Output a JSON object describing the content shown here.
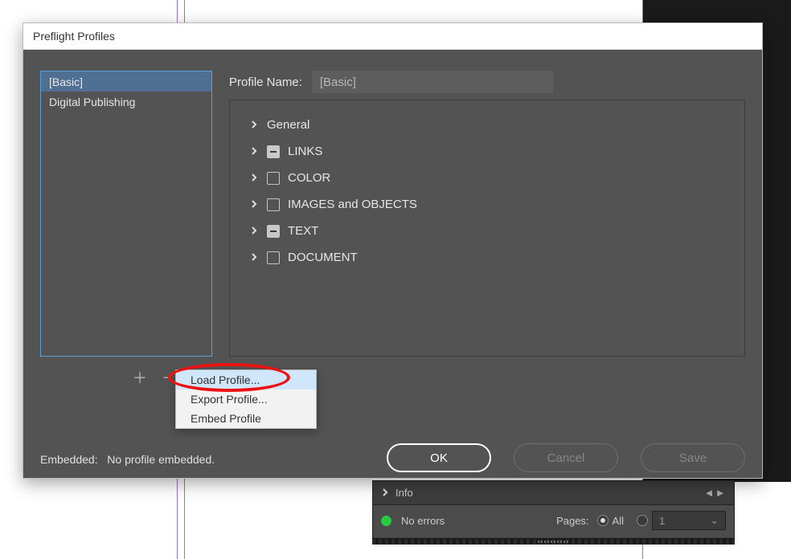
{
  "dialog": {
    "title": "Preflight Profiles",
    "profile_name_label": "Profile Name:",
    "profile_name_value": "[Basic]",
    "embedded_label": "Embedded:",
    "embedded_value": "No profile embedded.",
    "buttons": {
      "ok": "OK",
      "cancel": "Cancel",
      "save": "Save"
    }
  },
  "profiles": [
    {
      "label": "[Basic]",
      "selected": true
    },
    {
      "label": "Digital Publishing",
      "selected": false
    }
  ],
  "categories": [
    {
      "label": "General",
      "check": "none"
    },
    {
      "label": "LINKS",
      "check": "indeterminate"
    },
    {
      "label": "COLOR",
      "check": "unchecked"
    },
    {
      "label": "IMAGES and OBJECTS",
      "check": "unchecked"
    },
    {
      "label": "TEXT",
      "check": "indeterminate"
    },
    {
      "label": "DOCUMENT",
      "check": "unchecked"
    }
  ],
  "menu": {
    "items": [
      {
        "label": "Load Profile...",
        "highlight": true
      },
      {
        "label": "Export Profile...",
        "highlight": false
      },
      {
        "label": "Embed Profile",
        "highlight": false
      }
    ]
  },
  "preflight_panel": {
    "info_label": "Info",
    "status_text": "No errors",
    "pages_label": "Pages:",
    "radios": {
      "all_label": "All"
    },
    "page_field_value": "1"
  }
}
